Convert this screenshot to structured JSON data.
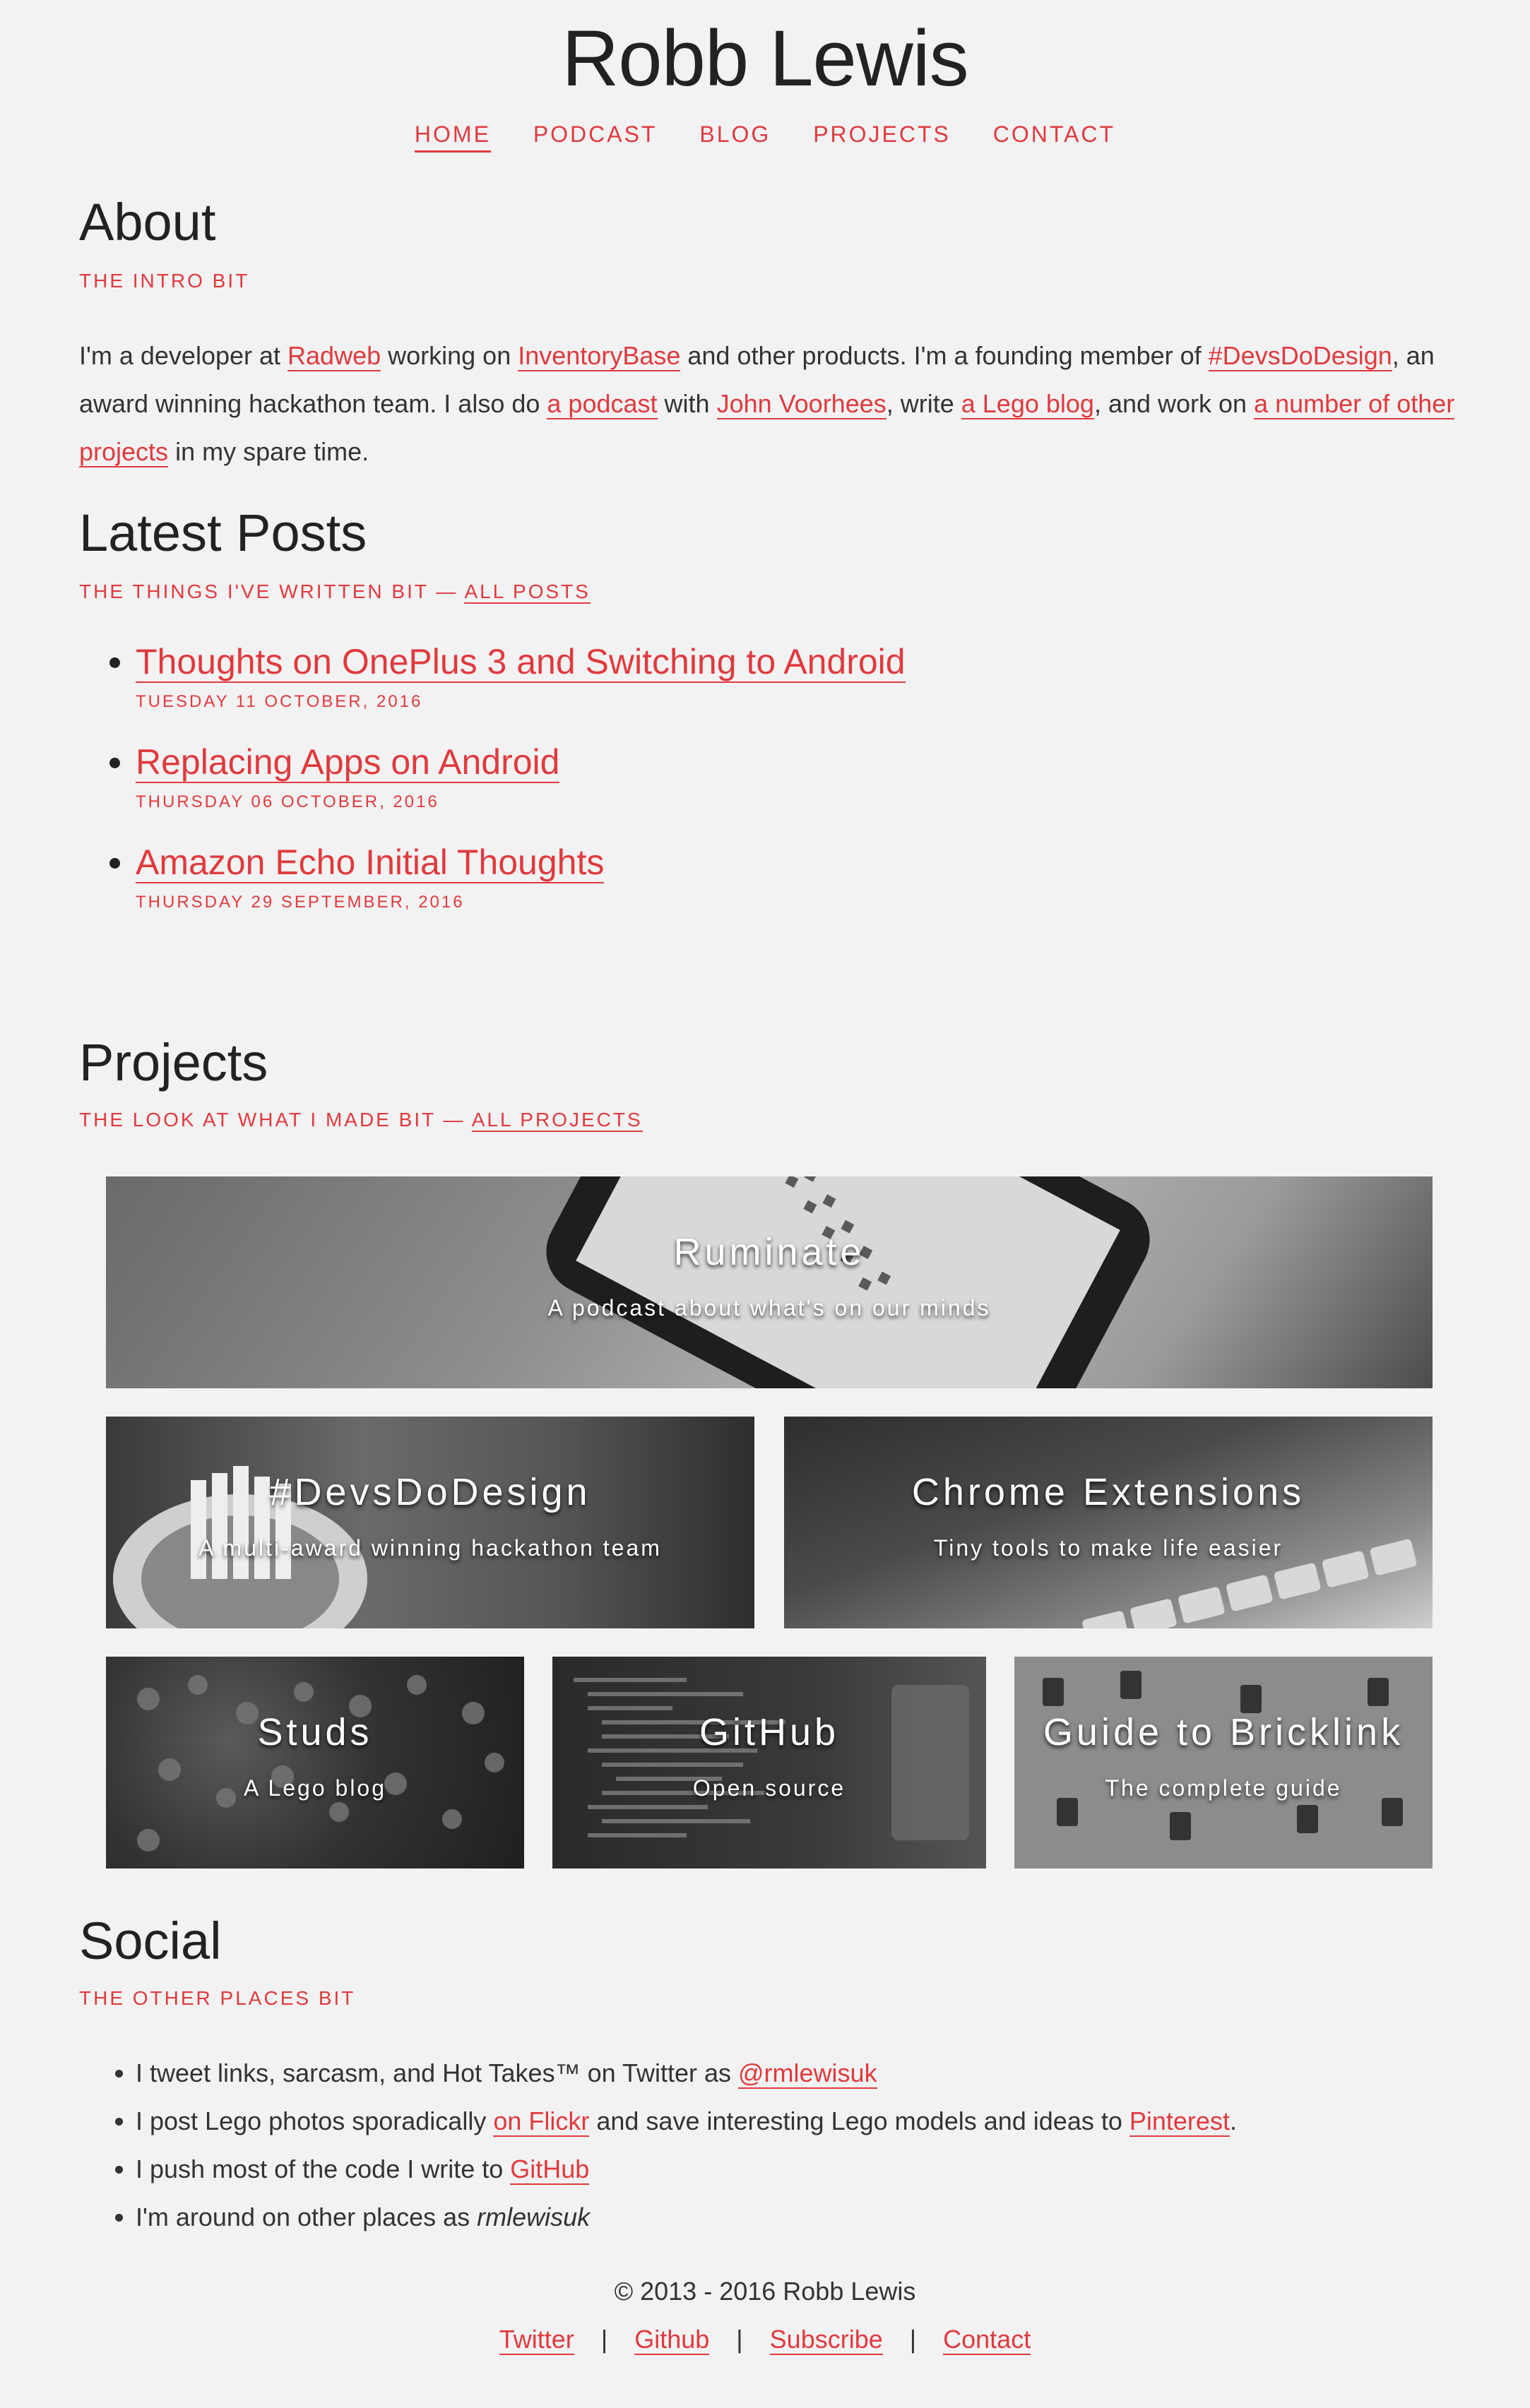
{
  "site": {
    "title": "Robb Lewis"
  },
  "nav": {
    "items": [
      "HOME",
      "PODCAST",
      "BLOG",
      "PROJECTS",
      "CONTACT"
    ]
  },
  "about": {
    "title": "About",
    "subtitle": "THE INTRO BIT",
    "t1": "I'm a developer at ",
    "l1": "Radweb",
    "t2": " working on ",
    "l2": "InventoryBase",
    "t3": " and other products. I'm a founding member of ",
    "l3": "#DevsDoDesign",
    "t4": ", an award winning hackathon team. I also do ",
    "l4": "a podcast",
    "t5": " with ",
    "l5": "John Voorhees",
    "t6": ", write ",
    "l6": "a Lego blog",
    "t7": ", and work on ",
    "l7": "a number of other projects",
    "t8": " in my spare time."
  },
  "latest": {
    "title": "Latest Posts",
    "subtitle": "THE THINGS I'VE WRITTEN BIT — ",
    "all_link": "ALL POSTS",
    "posts": [
      {
        "title": "Thoughts on OnePlus 3 and Switching to Android",
        "date": "TUESDAY 11 OCTOBER, 2016"
      },
      {
        "title": "Replacing Apps on Android",
        "date": "THURSDAY 06 OCTOBER, 2016"
      },
      {
        "title": "Amazon Echo Initial Thoughts",
        "date": "THURSDAY 29 SEPTEMBER, 2016"
      }
    ]
  },
  "projects": {
    "title": "Projects",
    "subtitle": "THE LOOK AT WHAT I MADE BIT — ",
    "all_link": "ALL PROJECTS",
    "items": [
      {
        "title": "Ruminate",
        "desc": "A podcast about what's on our minds"
      },
      {
        "title": "#DevsDoDesign",
        "desc": "A multi-award winning hackathon team"
      },
      {
        "title": "Chrome Extensions",
        "desc": "Tiny tools to make life easier"
      },
      {
        "title": "Studs",
        "desc": "A Lego blog"
      },
      {
        "title": "GitHub",
        "desc": "Open source"
      },
      {
        "title": "Guide to Bricklink",
        "desc": "The complete guide"
      }
    ]
  },
  "social": {
    "title": "Social",
    "subtitle": "THE OTHER PLACES BIT",
    "i1a": "I tweet links, sarcasm, and Hot Takes™ on Twitter as ",
    "i1l": "@rmlewisuk",
    "i2a": "I post Lego photos sporadically ",
    "i2l1": "on Flickr",
    "i2b": " and save interesting Lego models and ideas to ",
    "i2l2": "Pinterest",
    "i2c": ".",
    "i3a": "I push most of the code I write to ",
    "i3l": "GitHub",
    "i4a": "I'm around on other places as ",
    "i4em": "rmlewisuk"
  },
  "footer": {
    "copyright": "© 2013 - 2016 Robb Lewis",
    "links": [
      "Twitter",
      "Github",
      "Subscribe",
      "Contact"
    ],
    "separator": "|"
  },
  "colors": {
    "accent": "#e03a3e",
    "background": "#f2f2f2",
    "text": "#333333"
  }
}
